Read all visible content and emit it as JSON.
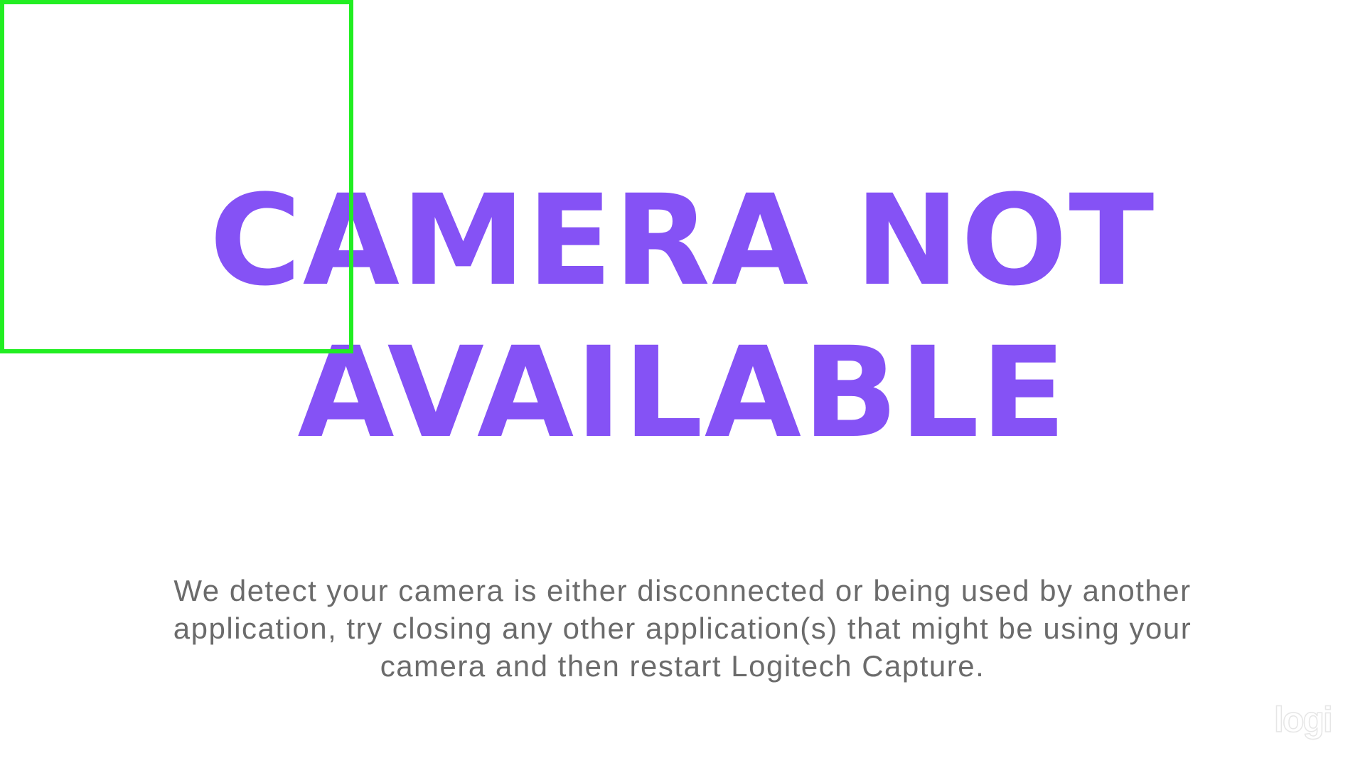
{
  "title": {
    "line1": "CAMERA NOT",
    "line2": "AVAILABLE"
  },
  "message": {
    "text": "We detect your camera is either disconnected or being used by another application, try closing any other application(s) that might be using your camera and then restart Logitech Capture."
  },
  "logo": {
    "text": "logi"
  },
  "colors": {
    "title": "#8552f5",
    "message": "#6b6b6b",
    "selection_box": "#22ee22",
    "background": "#ffffff"
  }
}
